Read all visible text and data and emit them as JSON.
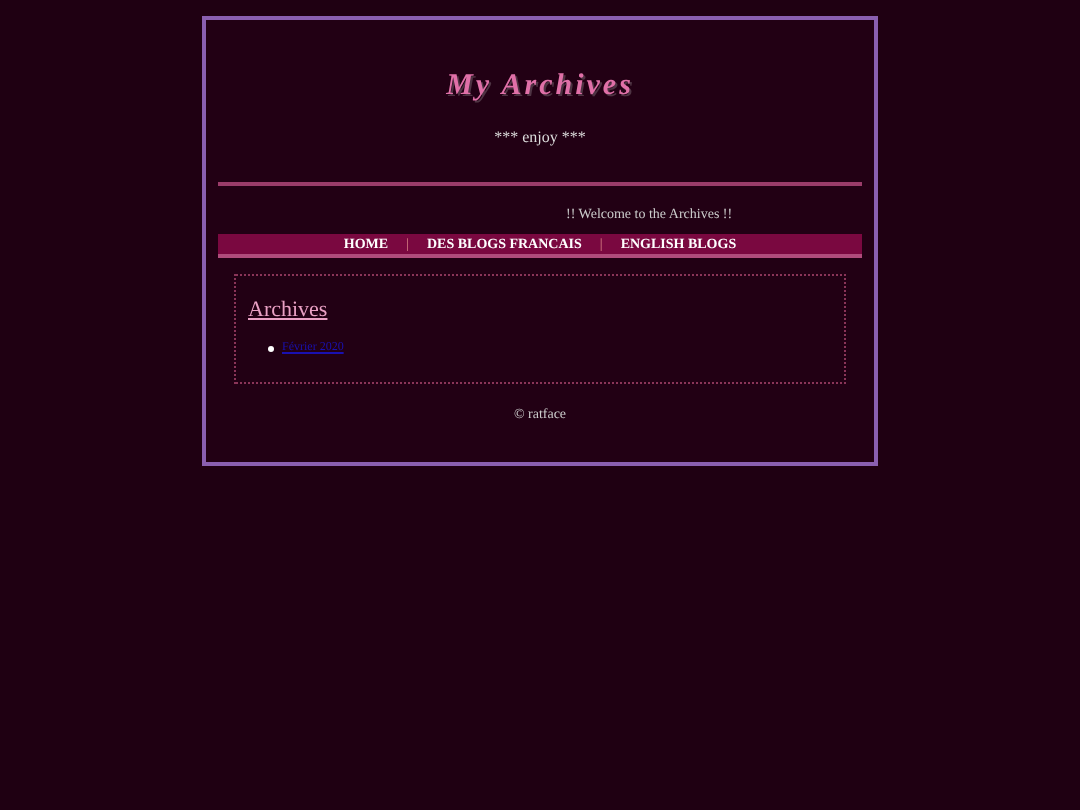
{
  "header": {
    "title": "My Archives",
    "subtitle": "*** enjoy ***"
  },
  "welcome": "!! Welcome to the Archives !!",
  "nav": {
    "items": [
      "HOME",
      "DES BLOGS FRANCAIS",
      "ENGLISH BLOGS"
    ],
    "separator": "|"
  },
  "archives": {
    "heading": "Archives",
    "links": [
      "Février 2020"
    ]
  },
  "footer": "© ratface"
}
